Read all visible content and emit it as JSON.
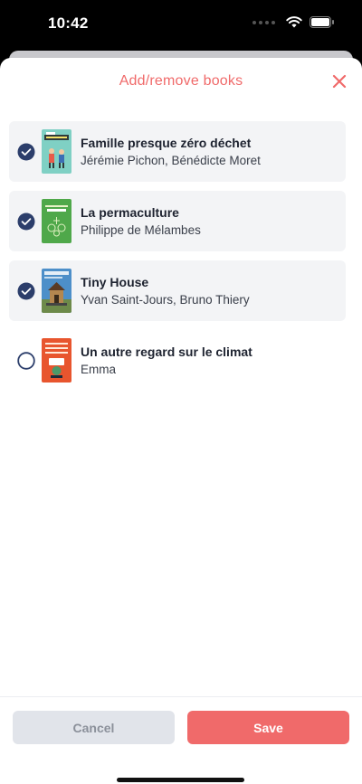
{
  "status_bar": {
    "time": "10:42"
  },
  "sheet": {
    "title": "Add/remove books",
    "close_icon": "close-x-icon"
  },
  "colors": {
    "accent": "#f06a6a",
    "check": "#2c3e6b",
    "row_selected_bg": "#f3f4f6"
  },
  "books": [
    {
      "title": "Famille presque zéro déchet",
      "author": "Jérémie Pichon, Bénédicte Moret",
      "selected": true,
      "cover": "zero-dechet-cover"
    },
    {
      "title": "La permaculture",
      "author": "Philippe de Mélambes",
      "selected": true,
      "cover": "permaculture-cover"
    },
    {
      "title": "Tiny House",
      "author": "Yvan Saint-Jours, Bruno Thiery",
      "selected": true,
      "cover": "tiny-house-cover"
    },
    {
      "title": "Un autre regard sur le climat",
      "author": "Emma",
      "selected": false,
      "cover": "climat-cover"
    }
  ],
  "footer": {
    "cancel_label": "Cancel",
    "save_label": "Save"
  }
}
